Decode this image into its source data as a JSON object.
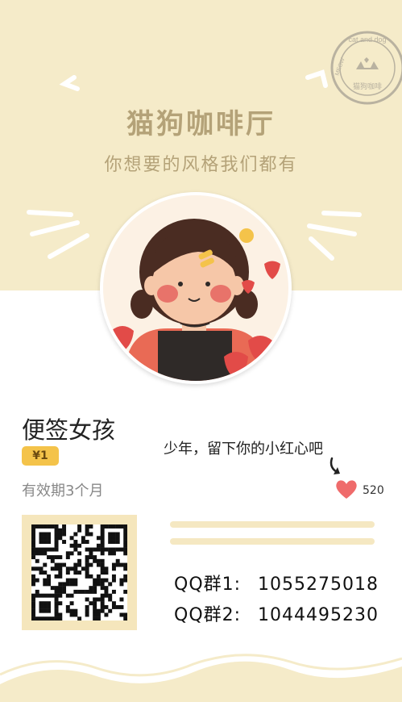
{
  "header": {
    "title": "猫狗咖啡厅",
    "subtitle": "你想要的风格我们都有",
    "stamp_text_top": "cat and dog",
    "stamp_text_side": "MEOW",
    "stamp_text_bottom": "猫狗咖啡"
  },
  "product": {
    "name": "便签女孩",
    "price": "¥1",
    "validity": "有效期3个月"
  },
  "likes": {
    "prompt": "少年，留下你的小红心吧",
    "count": "520"
  },
  "contact": {
    "groups": [
      {
        "label": "QQ群1:",
        "number": "1055275018"
      },
      {
        "label": "QQ群2:",
        "number": "1044495230"
      }
    ]
  },
  "colors": {
    "band": "#f5ebc9",
    "accent_text": "#b4a278",
    "price_badge": "#f4c34a",
    "heart": "#ef6b6b",
    "qr_frame": "#f5e6bc"
  },
  "icons": [
    "stamp-icon",
    "arrow-icon",
    "heart-icon",
    "qr-code"
  ]
}
